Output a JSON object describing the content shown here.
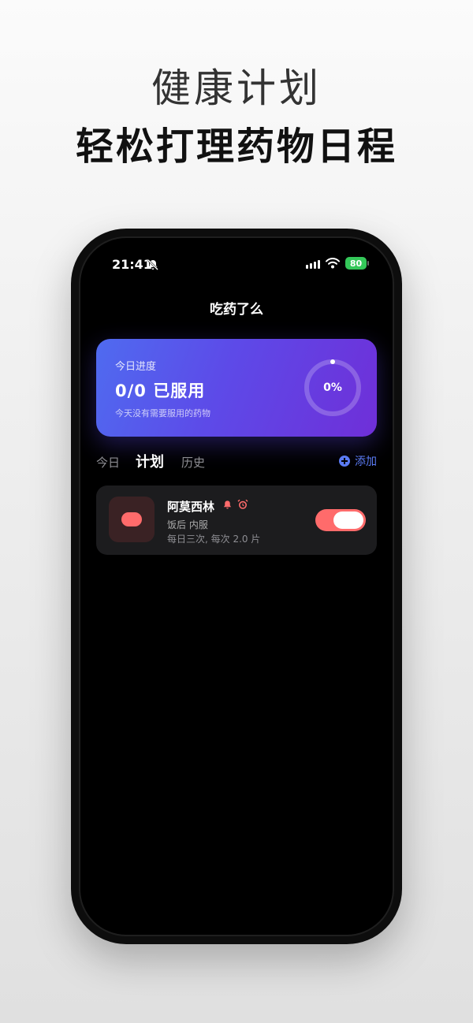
{
  "headline": {
    "line1": "健康计划",
    "line2": "轻松打理药物日程"
  },
  "status_bar": {
    "time": "21:41",
    "battery": "80",
    "icons": [
      "bell-off-icon",
      "signal-icon",
      "wifi-icon",
      "battery-icon"
    ]
  },
  "nav": {
    "title": "吃药了么"
  },
  "progress_card": {
    "label": "今日进度",
    "main": "0/0 已服用",
    "subtitle": "今天没有需要服用的药物",
    "percent_text": "0%",
    "percent_value": 0,
    "colors": {
      "start": "#4f6bf0",
      "end": "#6f2fd8"
    }
  },
  "tabs": [
    {
      "label": "今日",
      "active": false
    },
    {
      "label": "计划",
      "active": true
    },
    {
      "label": "历史",
      "active": false
    }
  ],
  "add_button": {
    "label": "添加",
    "color": "#5b7bf5"
  },
  "medications": [
    {
      "name": "阿莫西林",
      "meal": "饭后 内服",
      "dose": "每日三次, 每次 2.0 片",
      "enabled": true,
      "icons": [
        "bell-icon",
        "alarm-clock-icon",
        "pill-icon"
      ],
      "accent": "#ff6b6b"
    }
  ]
}
